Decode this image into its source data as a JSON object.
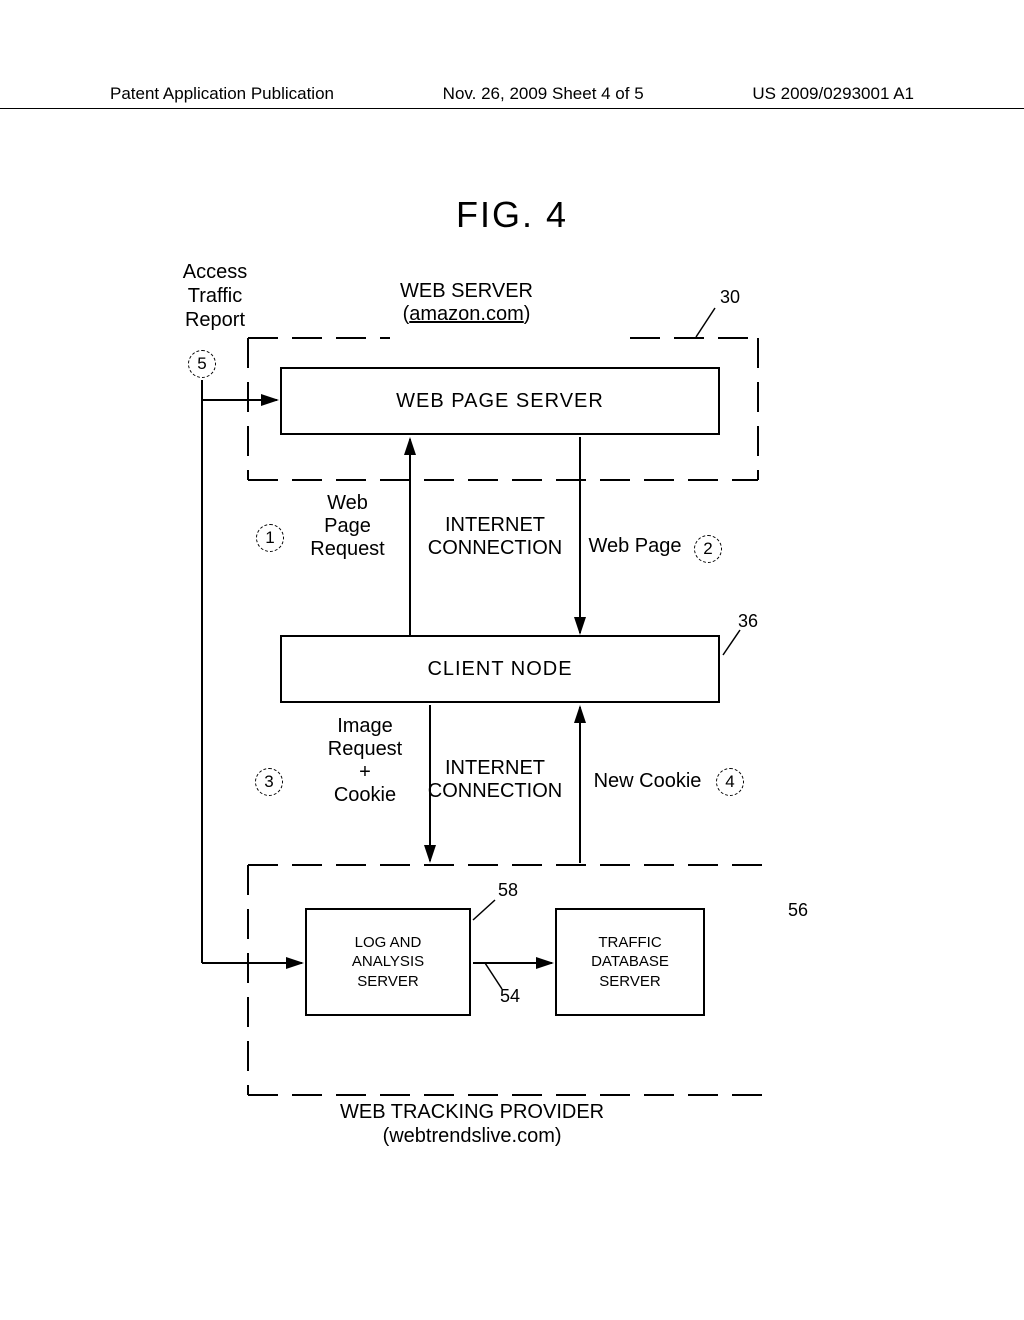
{
  "header": {
    "left": "Patent Application Publication",
    "center": "Nov. 26, 2009  Sheet 4 of 5",
    "right": "US 2009/0293001 A1"
  },
  "figure_title": "FIG. 4",
  "labels": {
    "access_traffic_report": "Access\nTraffic\nReport",
    "web_server_title_line1": "WEB SERVER",
    "web_server_title_line2": "(amazon.com)",
    "web_page_server": "WEB PAGE SERVER",
    "client_node": "CLIENT NODE",
    "log_analysis": "LOG AND\nANALYSIS\nSERVER",
    "traffic_db": "TRAFFIC\nDATABASE\nSERVER",
    "tracking_provider_line1": "WEB TRACKING PROVIDER",
    "tracking_provider_line2": "(webtrendslive.com)",
    "web_page_request": "Web\nPage\nRequest",
    "internet_conn_1": "INTERNET\nCONNECTION",
    "web_page": "Web Page",
    "image_request_cookie": "Image\nRequest\n+\nCookie",
    "internet_conn_2": "INTERNET\nCONNECTION",
    "new_cookie": "New Cookie"
  },
  "circles": {
    "c1": "1",
    "c2": "2",
    "c3": "3",
    "c4": "4",
    "c5": "5"
  },
  "refs": {
    "r30": "30",
    "r36": "36",
    "r54": "54",
    "r56": "56",
    "r58": "58"
  }
}
